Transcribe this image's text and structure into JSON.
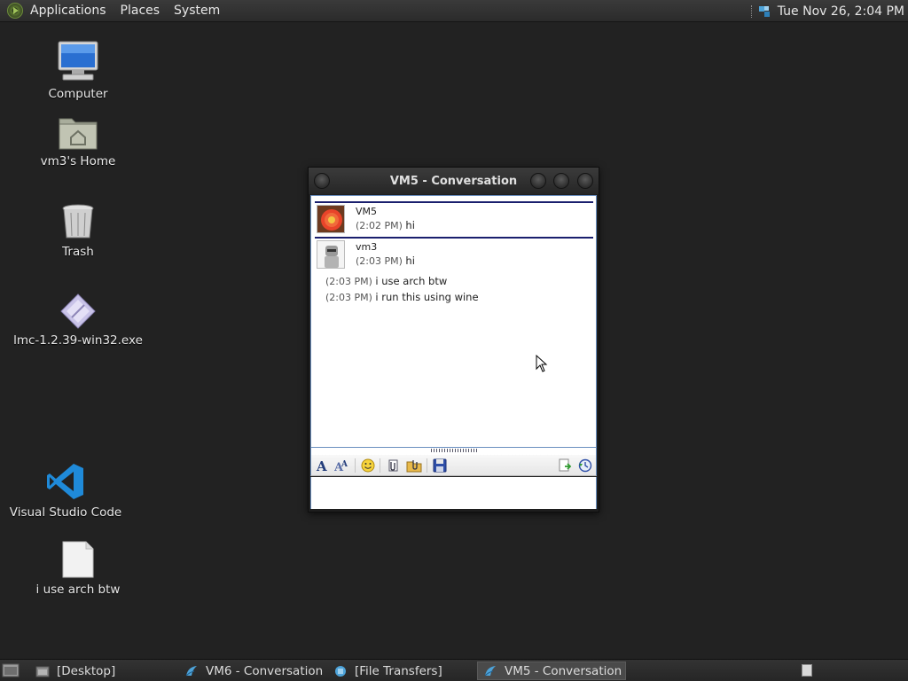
{
  "top_panel": {
    "menus": [
      "Applications",
      "Places",
      "System"
    ],
    "clock": "Tue Nov 26,  2:04 PM"
  },
  "desktop_icons": {
    "computer": "Computer",
    "home": "vm3's Home",
    "trash": "Trash",
    "exe": "lmc-1.2.39-win32.exe",
    "vscode": "Visual Studio Code",
    "file": "i use arch btw"
  },
  "window": {
    "title": "VM5 - Conversation",
    "messages": [
      {
        "sender": "VM5",
        "time": "(2:02 PM)",
        "text": "hi"
      },
      {
        "sender": "vm3",
        "time": "(2:03 PM)",
        "text": "hi"
      },
      {
        "time": "(2:03 PM)",
        "text": "i use arch btw"
      },
      {
        "time": "(2:03 PM)",
        "text": "i run this using wine"
      }
    ]
  },
  "taskbar": {
    "tasks": [
      "[Desktop]",
      "VM6 - Conversation",
      "[File Transfers]",
      "VM5 - Conversation"
    ]
  },
  "colors": {
    "desktop": "#222222",
    "divider": "#1a1f6e",
    "window_border": "#6a8fbf"
  }
}
